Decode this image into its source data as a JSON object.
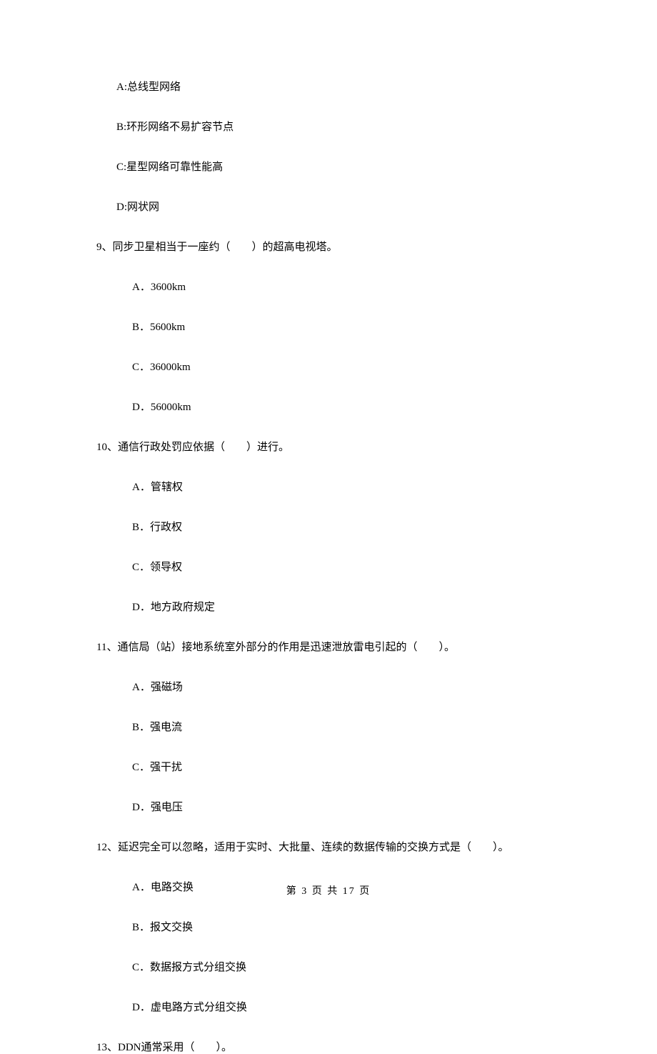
{
  "q8_options": {
    "a": "A:总线型网络",
    "b": "B:环形网络不易扩容节点",
    "c": "C:星型网络可靠性能高",
    "d": "D:网状网"
  },
  "q9": {
    "text": "9、同步卫星相当于一座约（　　）的超高电视塔。",
    "a": "A．3600km",
    "b": "B．5600km",
    "c": "C．36000km",
    "d": "D．56000km"
  },
  "q10": {
    "text": "10、通信行政处罚应依据（　　）进行。",
    "a": "A．管辖权",
    "b": "B．行政权",
    "c": "C．领导权",
    "d": "D．地方政府规定"
  },
  "q11": {
    "text": "11、通信局（站）接地系统室外部分的作用是迅速泄放雷电引起的（　　）。",
    "a": "A．强磁场",
    "b": "B．强电流",
    "c": "C．强干扰",
    "d": "D．强电压"
  },
  "q12": {
    "text": "12、延迟完全可以忽略，适用于实时、大批量、连续的数据传输的交换方式是（　　）。",
    "a": "A．电路交换",
    "b": "B．报文交换",
    "c": "C．数据报方式分组交换",
    "d": "D．虚电路方式分组交换"
  },
  "q13": {
    "text": "13、DDN通常采用（　　）。"
  },
  "footer": "第 3 页 共 17 页"
}
